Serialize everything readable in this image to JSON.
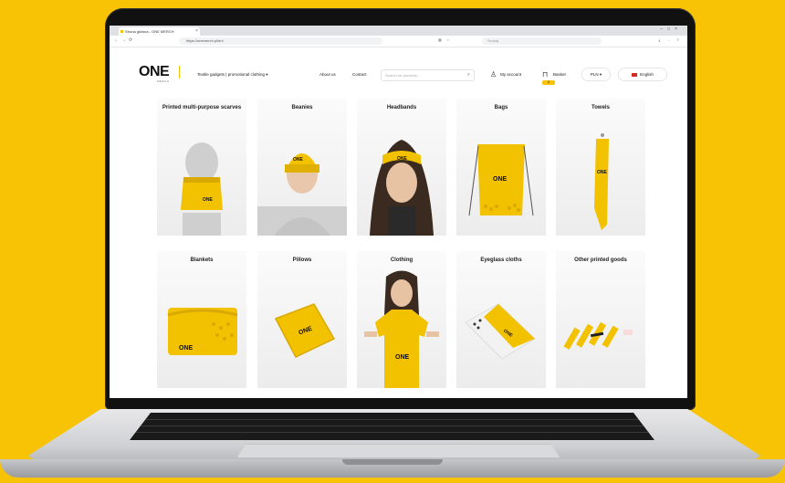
{
  "browser": {
    "tab_title": "Strona główna - ONE MERCH",
    "url": "https://onemerch.pl/en/",
    "search_placeholder": "Szukaj"
  },
  "site": {
    "logo": "ONE",
    "logo_sub": "MERCH",
    "nav": [
      "Textile gadgets | promotional clothing",
      "About us",
      "Contact"
    ],
    "search_placeholder": "Search for products...",
    "account_label": "My account",
    "basket_label": "Basket",
    "basket_count": "0",
    "currency": "PLN",
    "language": "English"
  },
  "products": [
    {
      "title": "Printed multi-purpose scarves"
    },
    {
      "title": "Beanies"
    },
    {
      "title": "Headbands"
    },
    {
      "title": "Bags"
    },
    {
      "title": "Towels"
    },
    {
      "title": "Blankets"
    },
    {
      "title": "Pillows"
    },
    {
      "title": "Clothing"
    },
    {
      "title": "Eyeglass cloths"
    },
    {
      "title": "Other printed goods"
    }
  ],
  "product_logo": "ONE",
  "colors": {
    "background": "#f8c304",
    "accent": "#f8c304",
    "text": "#222222"
  }
}
